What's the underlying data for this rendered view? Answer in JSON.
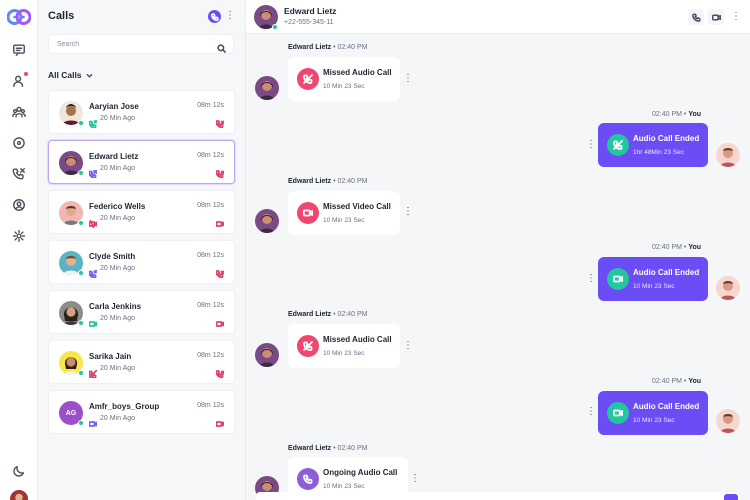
{
  "colors": {
    "accent": "#6c4cf5",
    "missed": "#ef476f",
    "ended": "#22c7a0",
    "ongoing": "#8e5ed6",
    "online": "#22c7a0"
  },
  "calls_panel": {
    "title": "Calls",
    "search_placeholder": "Search",
    "filter_label": "All Calls",
    "more_icon": "⋮"
  },
  "calls": [
    {
      "name": "Aaryian Jose",
      "time": "20 Min Ago",
      "duration": "08m 12s",
      "direction": "incoming",
      "type": "audio"
    },
    {
      "name": "Edward Lietz",
      "time": "20 Min Ago",
      "duration": "08m 12s",
      "direction": "missed",
      "type": "audio"
    },
    {
      "name": "Federico Wells",
      "time": "20 Min Ago",
      "duration": "08m 12s",
      "direction": "video-missed",
      "type": "video"
    },
    {
      "name": "Clyde Smith",
      "time": "20 Min Ago",
      "duration": "08m 12s",
      "direction": "incoming",
      "type": "audio"
    },
    {
      "name": "Carla Jenkins",
      "time": "20 Min Ago",
      "duration": "08m 12s",
      "direction": "video-incoming",
      "type": "video"
    },
    {
      "name": "Sarika Jain",
      "time": "20 Min Ago",
      "duration": "08m 12s",
      "direction": "declined",
      "type": "audio"
    },
    {
      "name": "Amfr_boys_Group",
      "initials": "AG",
      "time": "20 Min Ago",
      "duration": "08m 12s",
      "direction": "video-group",
      "type": "video"
    }
  ],
  "chat_header": {
    "name": "Edward Lietz",
    "phone": "+22-555-345-11",
    "more_icon": "⋮"
  },
  "messages": [
    {
      "sender": "Edward Lietz",
      "time": "02:40 PM",
      "title": "Missed Audio Call",
      "sub": "10 Min 23 Sec",
      "kind": "missed-audio"
    },
    {
      "sender": "You",
      "time": "02:40 PM",
      "title": "Audio Call Ended",
      "sub": "1hr 48Min 23 Sec",
      "kind": "ended-audio"
    },
    {
      "sender": "Edward Lietz",
      "time": "02:40 PM",
      "title": "Missed Video Call",
      "sub": "10 Min 23 Sec",
      "kind": "missed-video"
    },
    {
      "sender": "You",
      "time": "02:40 PM",
      "title": "Audio Call Ended",
      "sub": "10 Min 23 Sec",
      "kind": "ended-video"
    },
    {
      "sender": "Edward Lietz",
      "time": "02:40 PM",
      "title": "Missed Audio Call",
      "sub": "10 Min 23 Sec",
      "kind": "missed-audio"
    },
    {
      "sender": "You",
      "time": "02:40 PM",
      "title": "Audio Call Ended",
      "sub": "10 Min 23 Sec",
      "kind": "ended-video"
    },
    {
      "sender": "Edward Lietz",
      "time": "02:40 PM",
      "title": "Ongoing Audio Call",
      "sub": "10 Min 23 Sec",
      "kind": "ongoing-audio"
    }
  ],
  "meta_separator": "•",
  "rail_icons": [
    "logo-icon",
    "chat-icon",
    "contacts-icon",
    "groups-icon",
    "status-icon",
    "calls-icon",
    "profile-icon",
    "settings-icon",
    "dark-mode-icon"
  ]
}
